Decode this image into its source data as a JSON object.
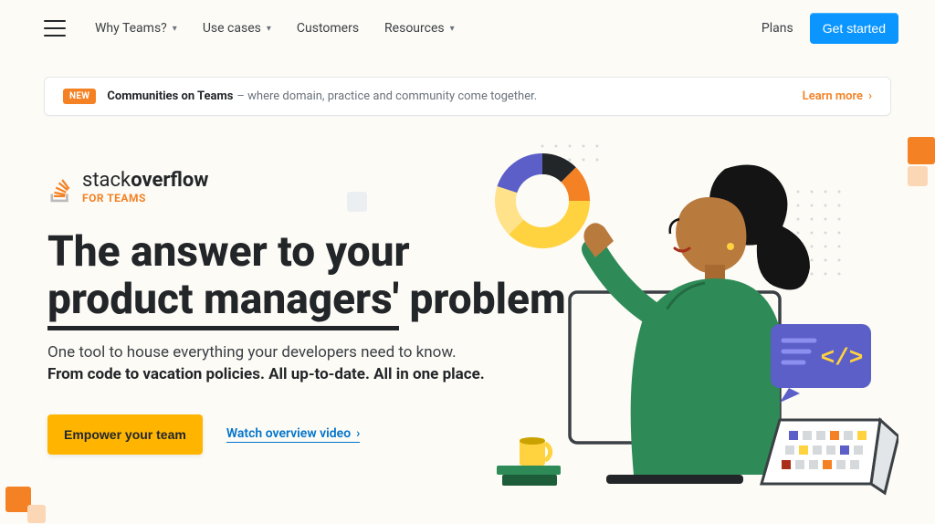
{
  "nav": {
    "items": [
      {
        "label": "Why Teams?",
        "hasDropdown": true
      },
      {
        "label": "Use cases",
        "hasDropdown": true
      },
      {
        "label": "Customers",
        "hasDropdown": false
      },
      {
        "label": "Resources",
        "hasDropdown": true
      }
    ],
    "plans": "Plans",
    "cta": "Get started"
  },
  "banner": {
    "badge": "NEW",
    "title": "Communities on Teams",
    "subtitle": "– where domain, practice and community come together.",
    "learn_more": "Learn more"
  },
  "logo": {
    "word1": "stack",
    "word2": "overflow",
    "sub": "FOR TEAMS"
  },
  "hero": {
    "headline_pre": "The answer to your",
    "headline_underlined": "product managers'",
    "headline_post": "problem",
    "sub1": "One tool to house everything your developers need to know.",
    "sub2": "From code to vacation policies. All up-to-date. All in one place.",
    "empower": "Empower your team",
    "watch": "Watch overview video"
  },
  "colors": {
    "accent_orange": "#f48225",
    "accent_yellow": "#ffb500",
    "accent_blue": "#0a95ff",
    "link_blue": "#0074cc"
  }
}
